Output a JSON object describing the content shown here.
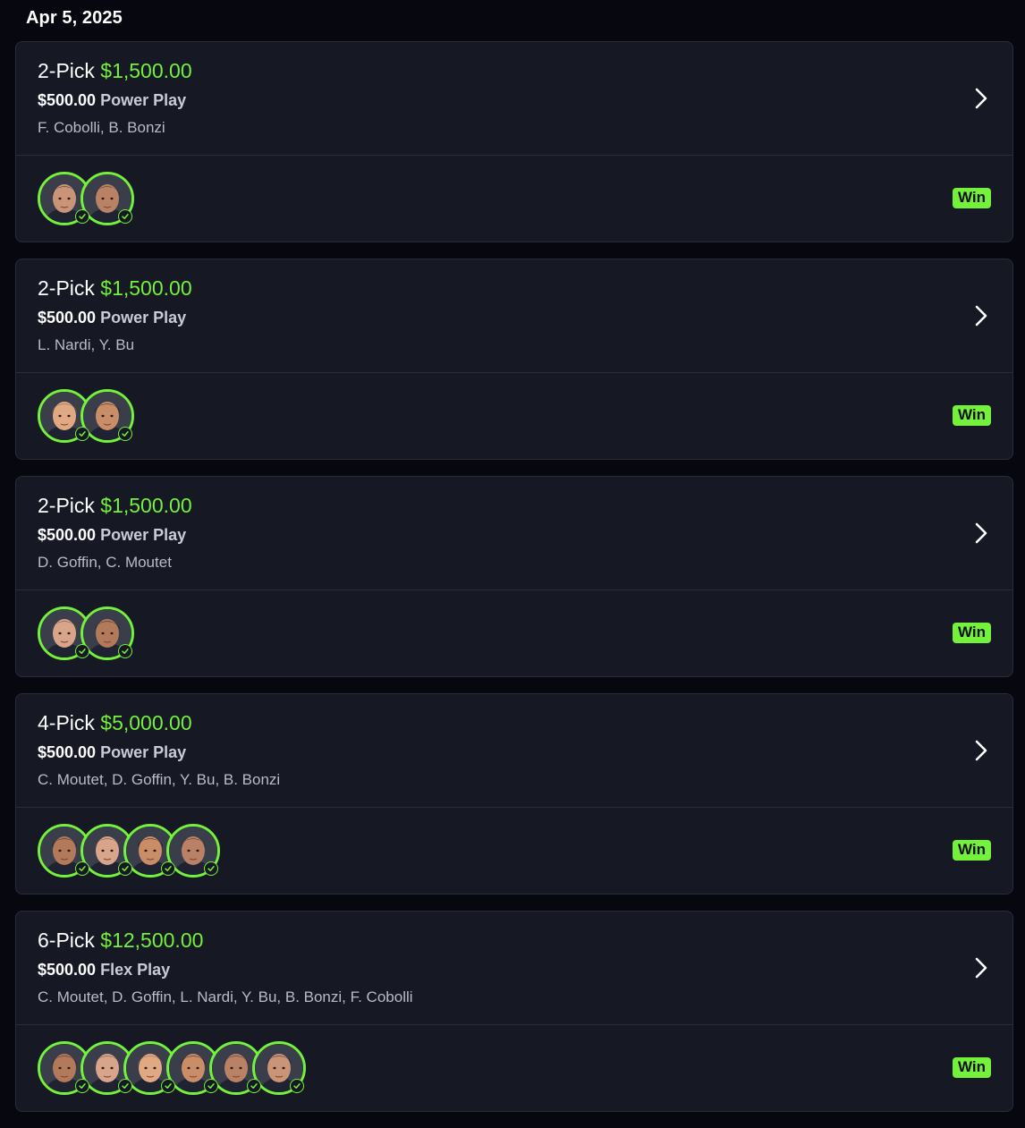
{
  "date": "Apr 5, 2025",
  "colors": {
    "accent": "#74f13a",
    "card": "#161824",
    "background": "#06070f"
  },
  "entries": [
    {
      "picks": "2-Pick",
      "payout": "$1,500.00",
      "stake": "$500.00",
      "play_type": "Power Play",
      "players": "F. Cobolli, B. Bonzi",
      "avatars": [
        {
          "player": "F. Cobolli",
          "skin": "#c99478",
          "hair": "#2a1d16"
        },
        {
          "player": "B. Bonzi",
          "skin": "#b98266",
          "hair": "#3b2a1f"
        }
      ],
      "result": "Win"
    },
    {
      "picks": "2-Pick",
      "payout": "$1,500.00",
      "stake": "$500.00",
      "play_type": "Power Play",
      "players": "L. Nardi, Y. Bu",
      "avatars": [
        {
          "player": "L. Nardi",
          "skin": "#e0a883",
          "hair": "#8a5a32"
        },
        {
          "player": "Y. Bu",
          "skin": "#c98d68",
          "hair": "#1d1410"
        }
      ],
      "result": "Win"
    },
    {
      "picks": "2-Pick",
      "payout": "$1,500.00",
      "stake": "$500.00",
      "play_type": "Power Play",
      "players": "D. Goffin, C. Moutet",
      "avatars": [
        {
          "player": "D. Goffin",
          "skin": "#d8a48a",
          "hair": "#5a4432"
        },
        {
          "player": "C. Moutet",
          "skin": "#b27a5a",
          "hair": "#2a1f18"
        }
      ],
      "result": "Win"
    },
    {
      "picks": "4-Pick",
      "payout": "$5,000.00",
      "stake": "$500.00",
      "play_type": "Power Play",
      "players": "C. Moutet, D. Goffin, Y. Bu, B. Bonzi",
      "avatars": [
        {
          "player": "C. Moutet",
          "skin": "#b27a5a",
          "hair": "#2a1f18"
        },
        {
          "player": "D. Goffin",
          "skin": "#d8a48a",
          "hair": "#5a4432"
        },
        {
          "player": "Y. Bu",
          "skin": "#c98d68",
          "hair": "#1d1410"
        },
        {
          "player": "B. Bonzi",
          "skin": "#b98266",
          "hair": "#3b2a1f"
        }
      ],
      "result": "Win"
    },
    {
      "picks": "6-Pick",
      "payout": "$12,500.00",
      "stake": "$500.00",
      "play_type": "Flex Play",
      "players": "C. Moutet, D. Goffin, L. Nardi, Y. Bu, B. Bonzi, F. Cobolli",
      "avatars": [
        {
          "player": "C. Moutet",
          "skin": "#b27a5a",
          "hair": "#2a1f18"
        },
        {
          "player": "D. Goffin",
          "skin": "#d8a48a",
          "hair": "#5a4432"
        },
        {
          "player": "L. Nardi",
          "skin": "#e0a883",
          "hair": "#8a5a32"
        },
        {
          "player": "Y. Bu",
          "skin": "#c98d68",
          "hair": "#1d1410"
        },
        {
          "player": "B. Bonzi",
          "skin": "#b98266",
          "hair": "#3b2a1f"
        },
        {
          "player": "F. Cobolli",
          "skin": "#c99478",
          "hair": "#2a1d16"
        }
      ],
      "result": "Win"
    }
  ]
}
